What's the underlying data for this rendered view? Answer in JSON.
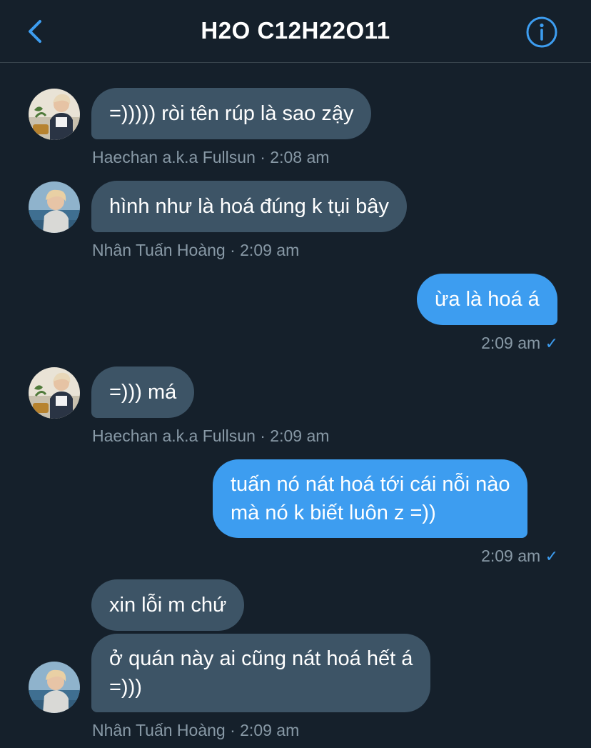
{
  "header": {
    "title": "H2O C12H22O11",
    "back_icon": "chevron-left-icon",
    "info_icon": "info-circle-icon",
    "accent": "#3d9df0"
  },
  "messages": [
    {
      "text": "=))))) ròi tên rúp là sao zậy",
      "meta": "Haechan a.k.a Fullsun · 2:08 am"
    },
    {
      "text": "hình như là hoá đúng k tụi bây",
      "meta": "Nhân Tuấn Hoàng · 2:09 am"
    },
    {
      "text": "ừa là hoá á",
      "meta": "2:09 am",
      "check": "✓"
    },
    {
      "text": "=))) má",
      "meta": "Haechan a.k.a Fullsun · 2:09 am"
    },
    {
      "line1": "tuấn nó nát hoá tới cái nỗi nào",
      "line2": "mà nó k biết luôn z =))",
      "meta": "2:09 am",
      "check": "✓"
    },
    {
      "text": "xin lỗi m chứ"
    },
    {
      "line1": "ở quán này ai cũng nát hoá hết á",
      "line2": "=)))",
      "meta": "Nhân Tuấn Hoàng · 2:09 am"
    }
  ],
  "colors": {
    "background": "#15202b",
    "incoming_bubble": "#3d5466",
    "outgoing_bubble": "#3d9df0",
    "meta_text": "#8899a6"
  }
}
